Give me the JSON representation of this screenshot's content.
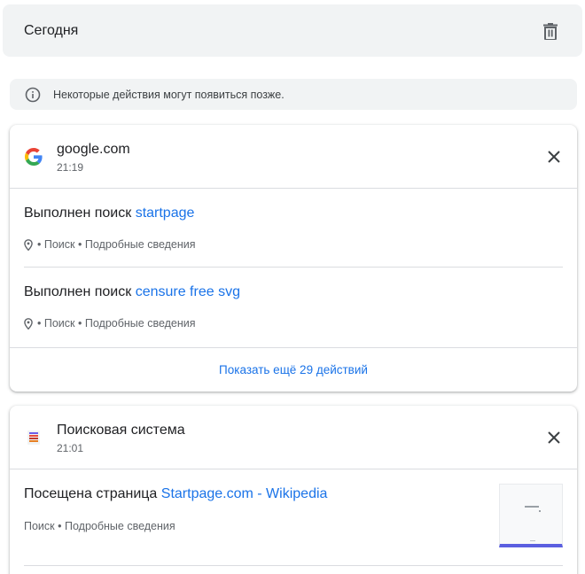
{
  "header": {
    "title": "Сегодня",
    "delete_icon": "trash-icon"
  },
  "notice": {
    "icon": "info-icon",
    "text": "Некоторые действия могут появиться позже."
  },
  "groups": [
    {
      "site": "google.com",
      "time": "21:19",
      "favicon": "google-logo-icon",
      "entries": [
        {
          "prefix": "Выполнен поиск",
          "link": "startpage",
          "meta_icon": "location-pin-icon",
          "meta_sep": "•",
          "meta_source": "Поиск",
          "meta_details": "Подробные сведения"
        },
        {
          "prefix": "Выполнен поиск",
          "link": "censure free svg",
          "meta_icon": "location-pin-icon",
          "meta_sep": "•",
          "meta_source": "Поиск",
          "meta_details": "Подробные сведения"
        }
      ],
      "show_more": "Показать ещё 29 действий"
    },
    {
      "site": "Поисковая система",
      "time": "21:01",
      "favicon": "startpage-logo-icon",
      "entries": [
        {
          "prefix": "Посещена страница",
          "link": "Startpage.com - Wikipedia",
          "meta_source": "Поиск",
          "meta_sep": "•",
          "meta_details": "Подробные сведения",
          "thumbnail": "page-thumbnail"
        }
      ]
    }
  ],
  "colors": {
    "link": "#1a73e8",
    "header_bg": "#f1f3f4",
    "muted_text": "#5f6368"
  }
}
